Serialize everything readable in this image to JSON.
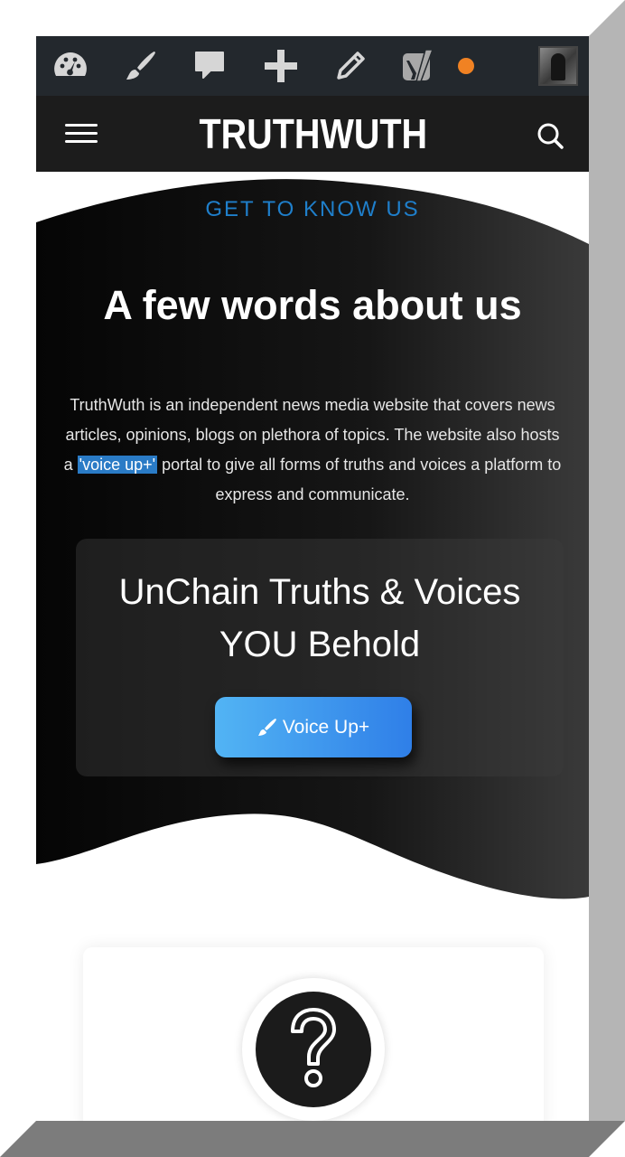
{
  "admin_bar": {
    "icons": [
      "dashboard-icon",
      "customize-brush-icon",
      "comments-icon",
      "new-plus-icon",
      "edit-pencil-icon",
      "yoast-seo-icon"
    ],
    "notification_color": "#f08223",
    "background": "#23282d"
  },
  "header": {
    "logo": "TRUTHWUTH",
    "menu_icon": "hamburger-menu-icon",
    "search_icon": "search-icon"
  },
  "hero": {
    "eyebrow": "GET TO KNOW US",
    "title": "A few words about us",
    "text_before": "TruthWuth is an independent news media website that covers news articles, opinions, blogs on plethora of topics. The website also hosts a ",
    "text_highlight": "'voice up+'",
    "text_after": " portal to give all forms of truths and voices a platform to express and communicate.",
    "accent_color": "#1f7fcb"
  },
  "cta": {
    "title_line1": "UnChain Truths & Voices",
    "title_line2": "YOU Behold",
    "button_label": "Voice Up+",
    "button_icon": "brush-icon"
  },
  "info_card": {
    "icon": "question-mark-icon"
  }
}
